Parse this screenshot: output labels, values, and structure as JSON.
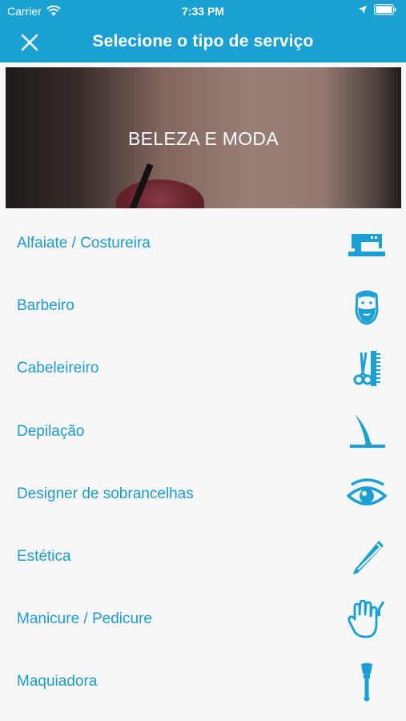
{
  "status_bar": {
    "carrier": "Carrier",
    "time": "7:33 PM"
  },
  "nav": {
    "title": "Selecione o tipo de serviço",
    "close_icon": "close-icon"
  },
  "hero": {
    "title": "BELEZA E MODA"
  },
  "services": [
    {
      "label": "Alfaiate / Costureira",
      "icon": "sewing-machine-icon"
    },
    {
      "label": "Barbeiro",
      "icon": "bearded-face-icon"
    },
    {
      "label": "Cabeleireiro",
      "icon": "comb-scissors-icon"
    },
    {
      "label": "Depilação",
      "icon": "hair-removal-icon"
    },
    {
      "label": "Designer de sobrancelhas",
      "icon": "eye-icon"
    },
    {
      "label": "Estética",
      "icon": "tweezers-icon"
    },
    {
      "label": "Manicure / Pedicure",
      "icon": "hand-icon"
    },
    {
      "label": "Maquiadora",
      "icon": "makeup-brush-icon"
    }
  ],
  "colors": {
    "primary": "#1aa0d3",
    "accent_text": "#1a9ccf",
    "background": "#f7f7f7"
  }
}
